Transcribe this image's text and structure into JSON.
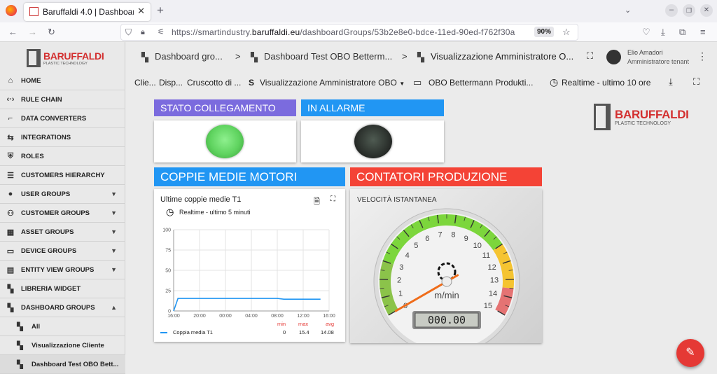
{
  "browser": {
    "tab_title": "Baruffaldi 4.0 | Dashboard",
    "url_prefix": "https://smartindustry.",
    "url_domain": "baruffaldi.eu",
    "url_rest": "/dashboardGroups/53b2e8e0-bdce-11ed-90ed-f762f30a",
    "zoom": "90%"
  },
  "sidebar": {
    "logo": "BARUFFALDI",
    "logo_sub": "PLASTIC TECHNOLOGY",
    "items": [
      {
        "label": "HOME",
        "icon": "home-icon"
      },
      {
        "label": "RULE CHAIN",
        "icon": "code-arrows-icon"
      },
      {
        "label": "DATA CONVERTERS",
        "icon": "transform-icon"
      },
      {
        "label": "INTEGRATIONS",
        "icon": "integration-icon"
      },
      {
        "label": "ROLES",
        "icon": "shield-icon"
      },
      {
        "label": "CUSTOMERS HIERARCHY",
        "icon": "hierarchy-icon"
      },
      {
        "label": "USER GROUPS",
        "icon": "user-group-icon"
      },
      {
        "label": "CUSTOMER GROUPS",
        "icon": "customers-icon"
      },
      {
        "label": "ASSET GROUPS",
        "icon": "asset-icon"
      },
      {
        "label": "DEVICE GROUPS",
        "icon": "device-icon"
      },
      {
        "label": "ENTITY VIEW GROUPS",
        "icon": "entity-view-icon"
      },
      {
        "label": "LIBRERIA WIDGET",
        "icon": "widget-icon"
      },
      {
        "label": "DASHBOARD GROUPS",
        "icon": "dashboard-icon"
      },
      {
        "label": "All",
        "icon": "dashboard-icon"
      },
      {
        "label": "Visualizzazione Cliente",
        "icon": "dashboard-icon"
      },
      {
        "label": "Dashboard Test OBO Bett...",
        "icon": "dashboard-icon"
      }
    ]
  },
  "topbar": {
    "crumb1": "Dashboard gro...",
    "crumb2": "Dashboard Test OBO Betterm...",
    "crumb3": "Visualizzazione Amministratore O...",
    "sep": ">",
    "user_name": "Elio Amadori",
    "user_role": "Amministratore tenant"
  },
  "subbar": {
    "item1": "Clie...",
    "item2": "Disp...",
    "item3": "Cruscotto di ...",
    "state_letter": "S",
    "state": "Visualizzazione Amministratore OBO",
    "entity": "OBO Bettermann Produkti...",
    "time": "Realtime - ultimo 10 ore"
  },
  "widgets": {
    "stato_title": "STATO COLLEGAMENTO",
    "allarme_title": "IN ALLARME",
    "coppie_title": "COPPIE MEDIE MOTORI",
    "contatori_title": "CONTATORI PRODUZIONE",
    "colors": {
      "stato": "#7b6bde",
      "allarme": "#2196f3",
      "coppie": "#2196f3",
      "contatori": "#f44336",
      "led_on": "#5fd35f",
      "led_off": "#3a3a3a"
    }
  },
  "chart_card": {
    "title": "Ultime coppie medie T1",
    "time": "Realtime - ultimo 5 minuti",
    "legend_headers": [
      "min",
      "max",
      "avg"
    ],
    "legend_row": {
      "name": "Coppia media T1",
      "min": "0",
      "max": "15.4",
      "avg": "14.08"
    }
  },
  "chart_data": {
    "type": "line",
    "title": "Ultime coppie medie T1",
    "ylim": [
      0,
      100
    ],
    "yticks": [
      "100",
      "75",
      "50",
      "25",
      "0"
    ],
    "xticks": [
      "16:00",
      "20:00",
      "00:00",
      "04:00",
      "08:00",
      "12:00",
      "16:00"
    ],
    "series": [
      {
        "name": "Coppia media T1",
        "color": "#2196f3",
        "x": [
          "16:00",
          "16:40",
          "17:30",
          "20:00",
          "00:00",
          "04:00",
          "08:00",
          "09:00",
          "12:00",
          "14:40"
        ],
        "values": [
          0,
          15.4,
          15.4,
          15.4,
          15.4,
          15.4,
          15.4,
          14.5,
          14.5,
          14.5
        ]
      }
    ]
  },
  "gauge": {
    "title": "VELOCITÀ ISTANTANEA",
    "unit": "m/min",
    "min": 0,
    "max": 15,
    "labels": [
      "0",
      "1",
      "2",
      "3",
      "4",
      "5",
      "6",
      "7",
      "8",
      "9",
      "10",
      "11",
      "12",
      "13",
      "14",
      "15"
    ],
    "value": 0,
    "lcd": "000.00"
  }
}
